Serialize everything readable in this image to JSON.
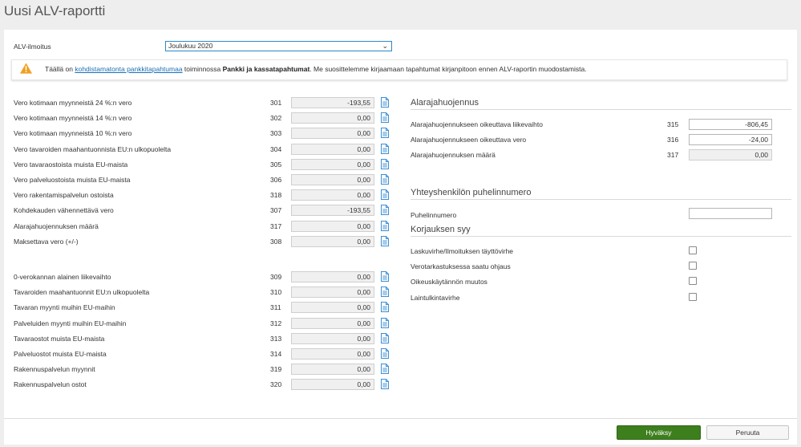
{
  "page_title": "Uusi ALV-raportti",
  "period": {
    "label": "ALV-ilmoitus",
    "selected": "Joulukuu 2020"
  },
  "warning": {
    "prefix": "Täällä on ",
    "link": "kohdistamatonta pankkitapahtumaa",
    "middle": " toiminnossa ",
    "bold": "Pankki ja kassatapahtumat",
    "suffix": ". Me suosittelemme kirjaamaan tapahtumat kirjanpitoon ennen ALV-raportin muodostamista."
  },
  "left_group1": [
    {
      "label": "Vero kotimaan myynneistä 24 %:n vero",
      "code": "301",
      "value": "-193,55"
    },
    {
      "label": "Vero kotimaan myynneistä 14 %:n vero",
      "code": "302",
      "value": "0,00"
    },
    {
      "label": "Vero kotimaan myynneistä 10 %:n vero",
      "code": "303",
      "value": "0,00"
    },
    {
      "label": "Vero tavaroiden maahantuonnista EU:n ulkopuolelta",
      "code": "304",
      "value": "0,00"
    },
    {
      "label": "Vero tavaraostoista muista EU-maista",
      "code": "305",
      "value": "0,00"
    },
    {
      "label": "Vero palveluostoista muista EU-maista",
      "code": "306",
      "value": "0,00"
    },
    {
      "label": "Vero rakentamispalvelun ostoista",
      "code": "318",
      "value": "0,00"
    },
    {
      "label": "Kohdekauden vähennettävä vero",
      "code": "307",
      "value": "-193,55"
    },
    {
      "label": "Alarajahuojennuksen määrä",
      "code": "317",
      "value": "0,00"
    },
    {
      "label": "Maksettava vero (+/-)",
      "code": "308",
      "value": "0,00"
    }
  ],
  "left_group2": [
    {
      "label": "0-verokannan alainen liikevaihto",
      "code": "309",
      "value": "0,00"
    },
    {
      "label": "Tavaroiden maahantuonnit EU:n ulkopuolelta",
      "code": "310",
      "value": "0,00"
    },
    {
      "label": "Tavaran myynti muihin EU-maihin",
      "code": "311",
      "value": "0,00"
    },
    {
      "label": "Palveluiden myynti muihin EU-maihin",
      "code": "312",
      "value": "0,00"
    },
    {
      "label": "Tavaraostot muista EU-maista",
      "code": "313",
      "value": "0,00"
    },
    {
      "label": "Palveluostot muista EU-maista",
      "code": "314",
      "value": "0,00"
    },
    {
      "label": "Rakennuspalvelun myynnit",
      "code": "319",
      "value": "0,00"
    },
    {
      "label": "Rakennuspalvelun ostot",
      "code": "320",
      "value": "0,00"
    }
  ],
  "relief": {
    "title": "Alarajahuojennus",
    "rows": [
      {
        "label": "Alarajahuojennukseen oikeuttava liikevaihto",
        "code": "315",
        "value": "-806,45",
        "editable": true
      },
      {
        "label": "Alarajahuojennukseen oikeuttava vero",
        "code": "316",
        "value": "-24,00",
        "editable": true
      },
      {
        "label": "Alarajahuojennuksen määrä",
        "code": "317",
        "value": "0,00",
        "editable": false
      }
    ]
  },
  "contact": {
    "title": "Yhteyshenkilön puhelinnumero",
    "phone_label": "Puhelinnumero",
    "phone_value": ""
  },
  "correction": {
    "title": "Korjauksen syy",
    "options": [
      {
        "label": "Laskuvirhe/Ilmoituksen täyttövirhe",
        "checked": false
      },
      {
        "label": "Verotarkastuksessa saatu ohjaus",
        "checked": false
      },
      {
        "label": "Oikeuskäytännön muutos",
        "checked": false
      },
      {
        "label": "Laintulkintavirhe",
        "checked": false
      }
    ]
  },
  "footer": {
    "ok_label": "Hyväksy",
    "cancel_label": "Peruuta"
  },
  "colors": {
    "accent": "#2e87c8",
    "ok_button": "#3e7f1d",
    "warning_icon": "#f0a020",
    "doc_icon": "#3a8fd6"
  }
}
